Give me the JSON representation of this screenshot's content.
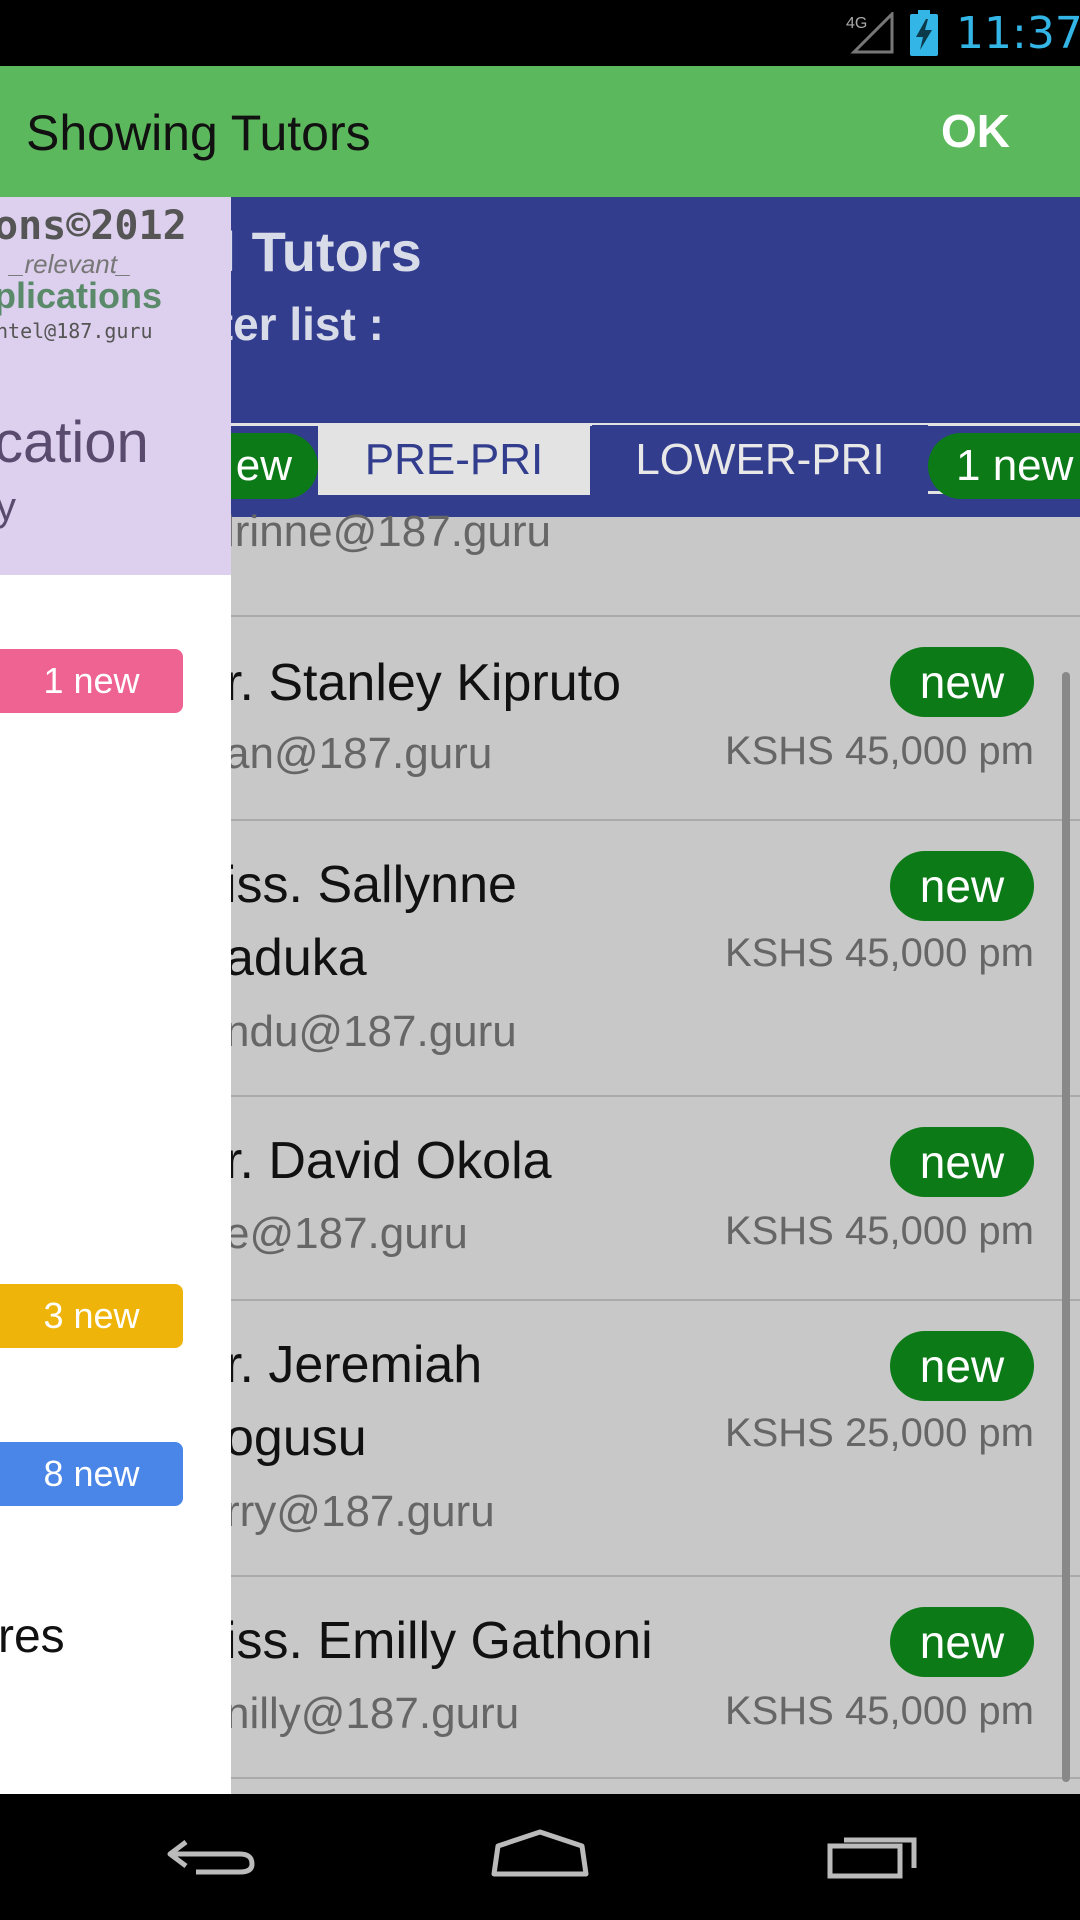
{
  "status_bar": {
    "network": "4G",
    "time": "11:37"
  },
  "action_bar": {
    "title": "Showing Tutors",
    "ok_label": "OK"
  },
  "header": {
    "title": "ll Tutors",
    "filter_label": "lter list :"
  },
  "tabs": {
    "left_pill": "ew",
    "pre_pri": "PRE-PRI",
    "lower_pri": "LOWER-PRI",
    "right_pill": "1 new"
  },
  "tutors": [
    {
      "name": "",
      "email": "lrinne@187.guru"
    },
    {
      "name": "r. Stanley Kipruto",
      "email": "an@187.guru",
      "badge": "new",
      "price": "KSHS 45,000 pm"
    },
    {
      "name_line1": "iss. Sallynne",
      "name_line2": "aduka",
      "email": "ndu@187.guru",
      "badge": "new",
      "price": "KSHS 45,000 pm"
    },
    {
      "name": "r. David Okola",
      "email": "e@187.guru",
      "badge": "new",
      "price": "KSHS 45,000 pm"
    },
    {
      "name_line1": "r. Jeremiah",
      "name_line2": "ogusu",
      "email": "rry@187.guru",
      "badge": "new",
      "price": "KSHS 25,000 pm"
    },
    {
      "name": "iss. Emilly Gathoni",
      "email": "nilly@187.guru",
      "badge": "new",
      "price": "KSHS 45,000 pm"
    }
  ],
  "drawer": {
    "logo": {
      "line1": "ons©2012",
      "line2": "_relevant_",
      "line3": "plications",
      "line4": "ntel@187.guru",
      "line5": "cation",
      "line6": "y"
    },
    "badges": {
      "pink": "1 new",
      "yellow": "3 new",
      "blue": "8 new"
    },
    "partial_item": "res"
  },
  "colors": {
    "accent_green": "#5cb85c",
    "header_blue": "#333d8e",
    "badge_green": "#0b7a17",
    "pink": "#ee6392",
    "yellow": "#eeb40a",
    "blue": "#4a86e8"
  },
  "icons": {
    "nav": [
      "back-icon",
      "home-icon",
      "recents-icon"
    ]
  }
}
